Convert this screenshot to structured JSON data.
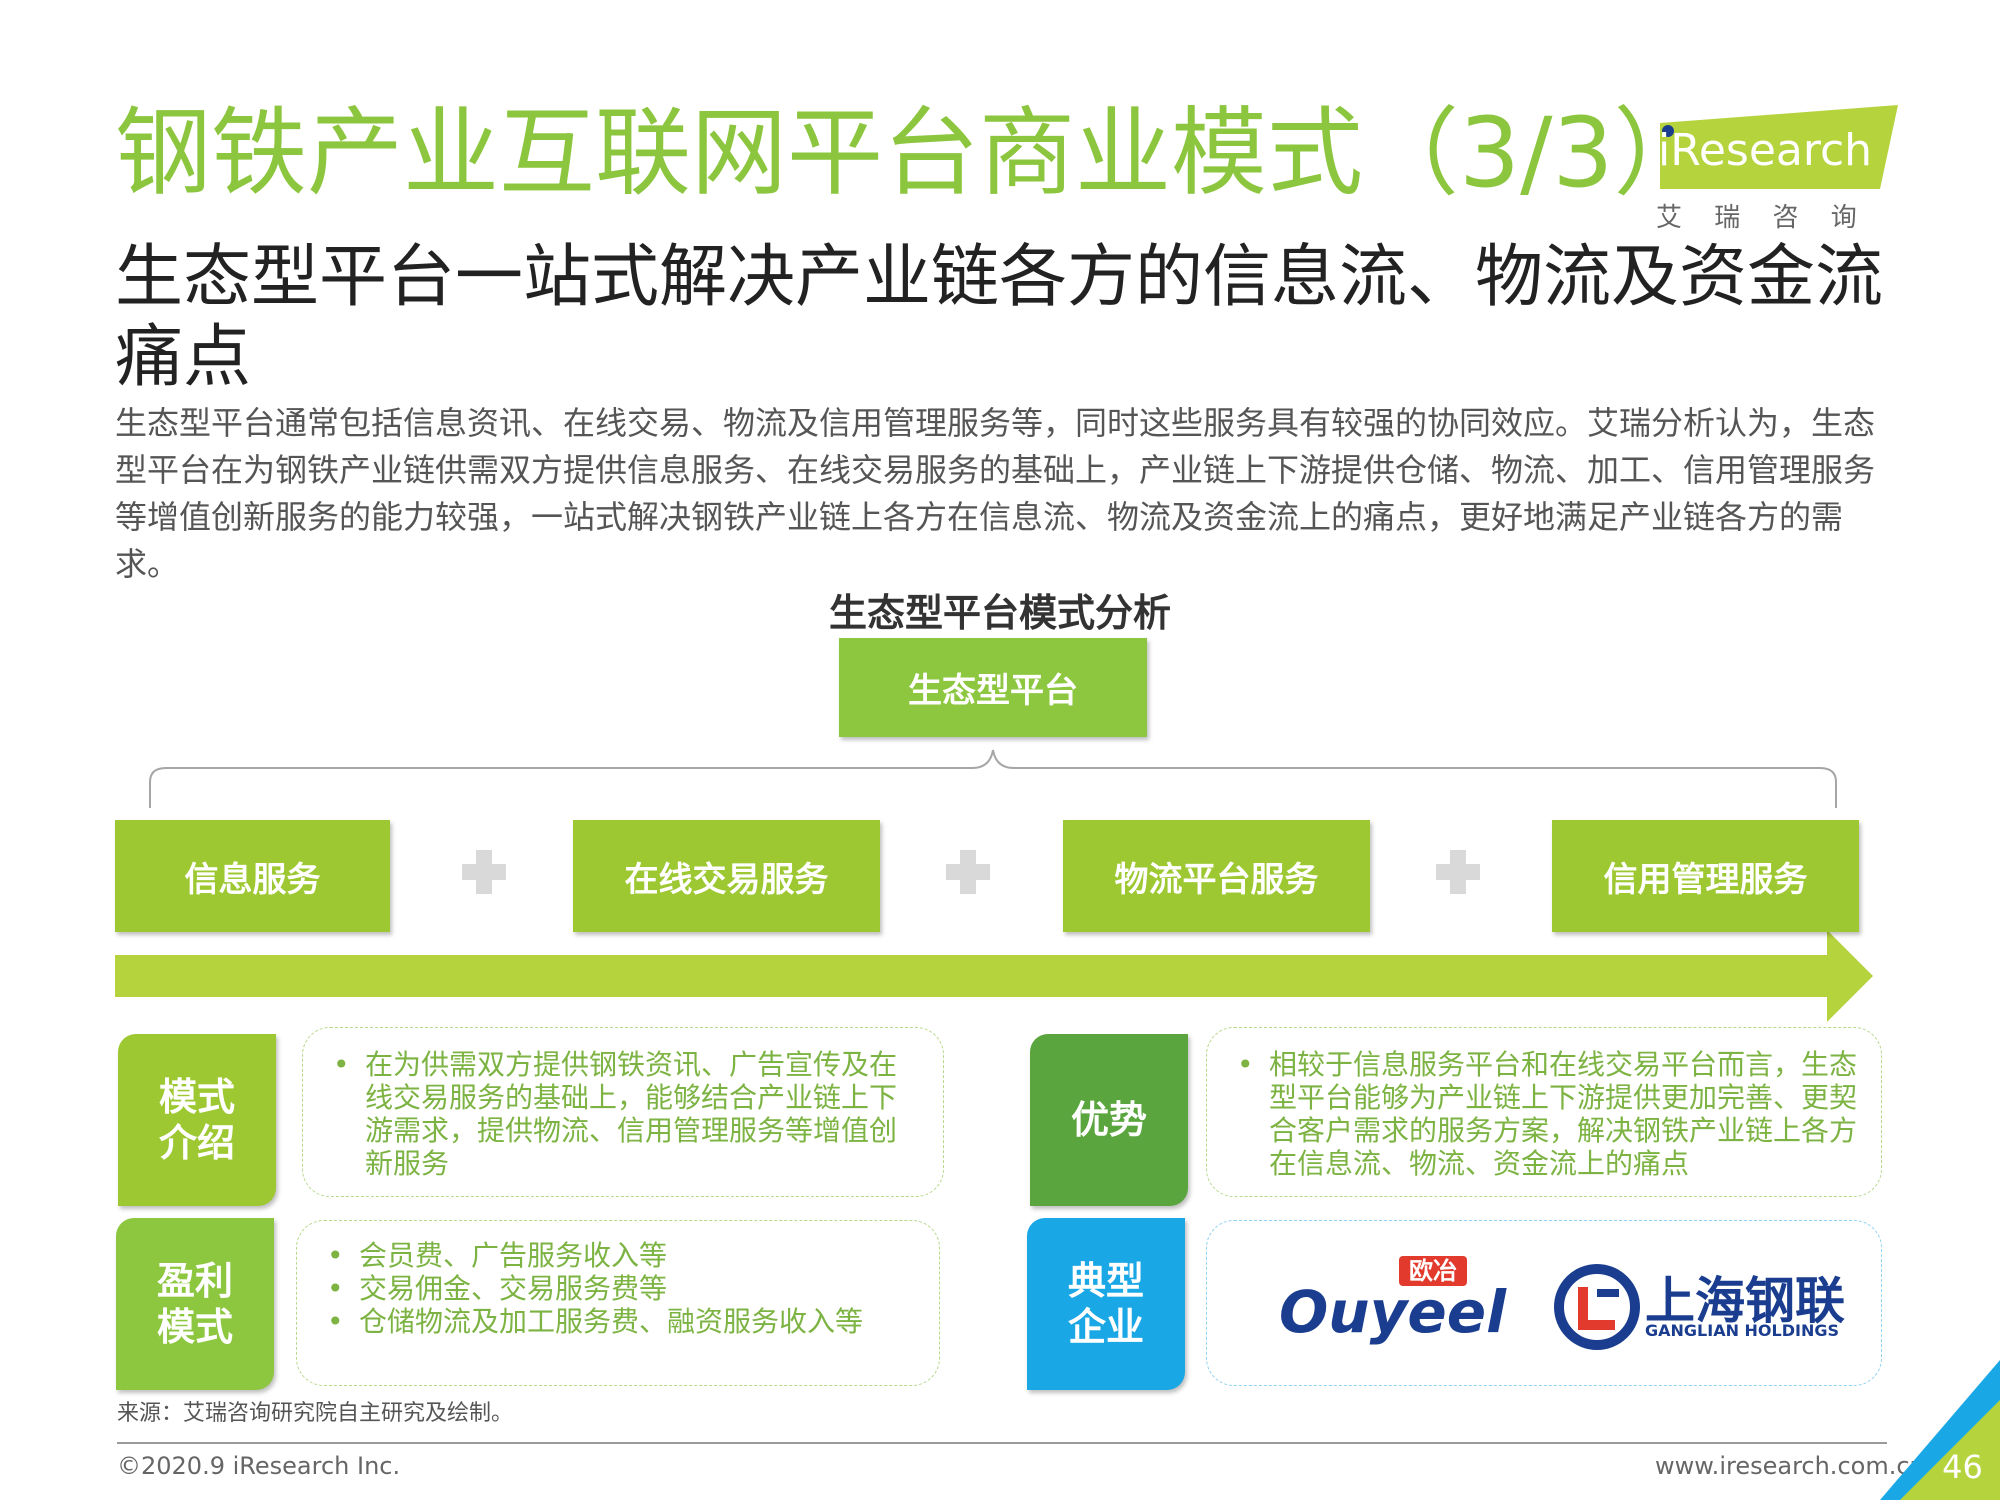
{
  "header": {
    "title": "钢铁产业互联网平台商业模式（3/3）",
    "logo_text": "iResearch",
    "logo_subtext": "艾 瑞 咨 询"
  },
  "subtitle": "生态型平台一站式解决产业链各方的信息流、物流及资金流痛点",
  "intro": "生态型平台通常包括信息资讯、在线交易、物流及信用管理服务等，同时这些服务具有较强的协同效应。艾瑞分析认为，生态型平台在为钢铁产业链供需双方提供信息服务、在线交易服务的基础上，产业链上下游提供仓储、物流、加工、信用管理服务等增值创新服务的能力较强，一站式解决钢铁产业链上各方在信息流、物流及资金流上的痛点，更好地满足产业链各方的需求。",
  "diagram": {
    "title": "生态型平台模式分析",
    "top_box": "生态型平台",
    "services": [
      "信息服务",
      "在线交易服务",
      "物流平台服务",
      "信用管理服务"
    ]
  },
  "cards": {
    "mode": {
      "label": "模式介绍",
      "bullets": [
        "在为供需双方提供钢铁资讯、广告宣传及在线交易服务的基础上，能够结合产业链上下游需求，提供物流、信用管理服务等增值创新服务"
      ]
    },
    "advantage": {
      "label": "优势",
      "bullets": [
        "相较于信息服务平台和在线交易平台而言，生态型平台能够为产业链上下游提供更加完善、更契合客户需求的服务方案，解决钢铁产业链上各方在信息流、物流、资金流上的痛点"
      ]
    },
    "profit": {
      "label": "盈利模式",
      "bullets": [
        "会员费、广告服务收入等",
        "交易佣金、交易服务费等",
        "仓储物流及加工服务费、融资服务收入等"
      ]
    },
    "companies": {
      "label": "典型企业",
      "ouyeel_cn": "欧冶",
      "ouyeel_en": "Ouyeel",
      "ganglian_cn": "上海钢联",
      "ganglian_en": "GANGLIAN HOLDINGS"
    }
  },
  "footer": {
    "source": "来源：艾瑞咨询研究院自主研究及绘制。",
    "copyright": "©2020.9 iResearch Inc.",
    "website": "www.iresearch.com.cn",
    "page": "46"
  },
  "colors": {
    "title_green": "#8cc63f",
    "box_green": "#9dc832",
    "dark_green": "#5aa53e",
    "blue": "#1aa7e6",
    "navy": "#1a3d8f",
    "red": "#e23b2e"
  }
}
